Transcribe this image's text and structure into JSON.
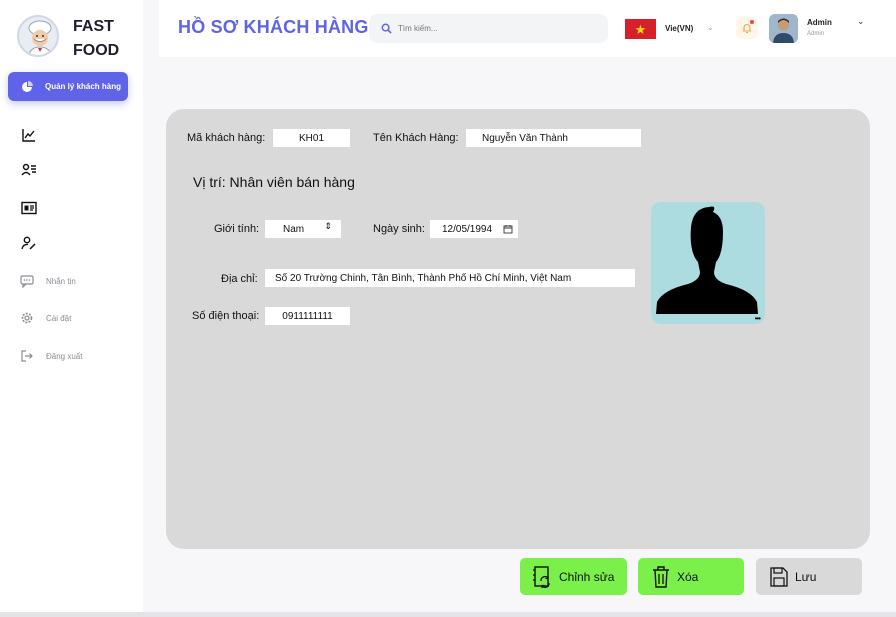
{
  "brand": {
    "line1": "FAST",
    "line2": "FOOD",
    "logo_icon": "chef-logo-icon"
  },
  "sidebar": {
    "active": {
      "label": "Quản lý khách hàng",
      "icon": "pie-chart-icon"
    },
    "icons": [
      "chart-line-icon",
      "user-list-icon",
      "id-card-icon",
      "user-edit-icon"
    ],
    "items": [
      {
        "label": "Nhắn tin",
        "icon": "chat-icon"
      },
      {
        "label": "Cài đặt",
        "icon": "gear-icon"
      },
      {
        "label": "Đăng xuất",
        "icon": "logout-icon"
      }
    ]
  },
  "header": {
    "title": "HỒ SƠ KHÁCH HÀNG",
    "search_placeholder": "Tìm kiếm...",
    "language": "Vie(VN)",
    "user_name": "Admin",
    "user_role": "Admin"
  },
  "form": {
    "customer_id_label": "Mã khách hàng:",
    "customer_id": "KH01",
    "customer_name_label": "Tên Khách Hàng:",
    "customer_name": "Nguyễn Văn Thành",
    "position": "Vị trí: Nhân viên bán hàng",
    "gender_label": "Giới tính:",
    "gender": "Nam",
    "birthdate_label": "Ngày sinh:",
    "birthdate": "12/05/1994",
    "address_label": "Địa chỉ:",
    "address": "Số 20 Trường Chinh, Tân Bình, Thành Phố Hồ Chí Minh, Việt Nam",
    "phone_label": "Số điện thoại:",
    "phone": "0911111111"
  },
  "actions": {
    "edit": "Chỉnh sửa",
    "delete": "Xóa",
    "save": "Lưu"
  },
  "colors": {
    "accent": "#5f63e8",
    "action_green": "#7cf04a",
    "card_gray": "#d9d9d9",
    "photo_bg": "#acdcdf"
  }
}
